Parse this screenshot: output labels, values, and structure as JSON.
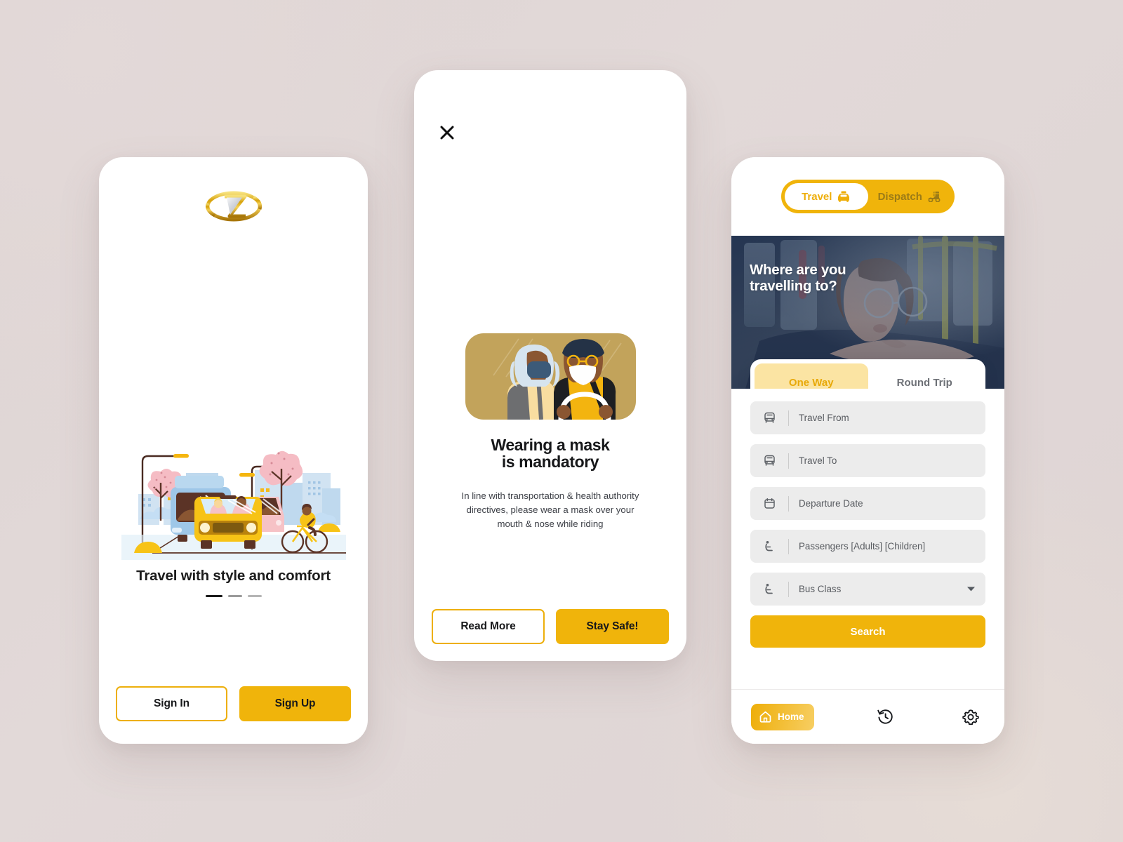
{
  "background_color": "#e0d7d6",
  "accent_yellow": "#f0b40b",
  "screen1": {
    "name": "onboarding",
    "logo_alt": "brand-logo",
    "caption": "Travel with style and comfort",
    "pagination": {
      "total": 3,
      "active_index": 0
    },
    "buttons": {
      "sign_in": "Sign In",
      "sign_up": "Sign Up"
    }
  },
  "screen2": {
    "name": "mask-notice",
    "close_icon": "close-icon",
    "illustration": "car-passengers-wearing-masks",
    "title_line1": "Wearing a mask",
    "title_line2": "is mandatory",
    "body": "In line with transportation & health authority directives, please wear a mask over your mouth & nose while riding",
    "buttons": {
      "read_more": "Read More",
      "stay_safe": "Stay Safe!"
    }
  },
  "screen3": {
    "name": "trip-search",
    "mode_toggle": {
      "options": [
        {
          "label": "Travel",
          "icon": "taxi-icon",
          "active": true
        },
        {
          "label": "Dispatch",
          "icon": "delivery-scooter-icon",
          "active": false
        }
      ]
    },
    "hero": {
      "title_line1": "Where are you",
      "title_line2": "travelling to?",
      "photo": "woman-inside-bus"
    },
    "trip_type": {
      "options": [
        {
          "label": "One Way",
          "active": true
        },
        {
          "label": "Round Trip",
          "active": false
        }
      ]
    },
    "form_fields": [
      {
        "label": "Travel From",
        "icon": "bus-icon",
        "type": "input",
        "value": ""
      },
      {
        "label": "Travel To",
        "icon": "bus-icon",
        "type": "input",
        "value": ""
      },
      {
        "label": "Departure Date",
        "icon": "calendar-icon",
        "type": "date",
        "value": ""
      },
      {
        "label": "Passengers [Adults] [Children]",
        "icon": "seat-icon",
        "type": "input",
        "value": ""
      },
      {
        "label": "Bus Class",
        "icon": "seat-icon",
        "type": "select",
        "value": "",
        "caret": "chevron-down-icon"
      }
    ],
    "search_button": "Search",
    "bottom_nav": [
      {
        "label": "Home",
        "icon": "home-icon",
        "active": true
      },
      {
        "label": "",
        "icon": "history-icon",
        "active": false
      },
      {
        "label": "",
        "icon": "gear-icon",
        "active": false
      }
    ]
  }
}
